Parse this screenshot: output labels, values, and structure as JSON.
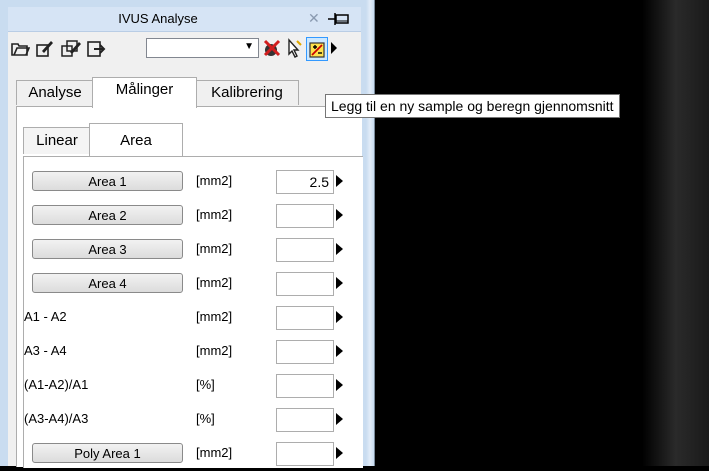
{
  "window": {
    "title": "IVUS Analyse"
  },
  "toolbar": {
    "icons": [
      "open-icon",
      "edit-icon",
      "edit-multi-icon",
      "export-icon",
      "delete-icon",
      "cursor-icon",
      "add-sample-icon",
      "more-icon"
    ],
    "combo_value": ""
  },
  "tabs": [
    {
      "label": "Analyse"
    },
    {
      "label": "Målinger"
    },
    {
      "label": "Kalibrering"
    }
  ],
  "subtabs": [
    {
      "label": "Linear"
    },
    {
      "label": "Area"
    }
  ],
  "rows": [
    {
      "label": "Area 1",
      "type": "button",
      "unit": "[mm2]",
      "value": "2.5"
    },
    {
      "label": "Area 2",
      "type": "button",
      "unit": "[mm2]",
      "value": ""
    },
    {
      "label": "Area 3",
      "type": "button",
      "unit": "[mm2]",
      "value": ""
    },
    {
      "label": "Area 4",
      "type": "button",
      "unit": "[mm2]",
      "value": ""
    },
    {
      "label": "A1 - A2",
      "type": "label",
      "unit": "[mm2]",
      "value": ""
    },
    {
      "label": "A3 - A4",
      "type": "label",
      "unit": "[mm2]",
      "value": ""
    },
    {
      "label": "(A1-A2)/A1",
      "type": "label",
      "unit": "[%]",
      "value": ""
    },
    {
      "label": "(A3-A4)/A3",
      "type": "label",
      "unit": "[%]",
      "value": ""
    },
    {
      "label": "Poly Area 1",
      "type": "button",
      "unit": "[mm2]",
      "value": ""
    }
  ],
  "tooltip": {
    "text": "Legg til en ny sample og beregn gjennomsnitt"
  }
}
